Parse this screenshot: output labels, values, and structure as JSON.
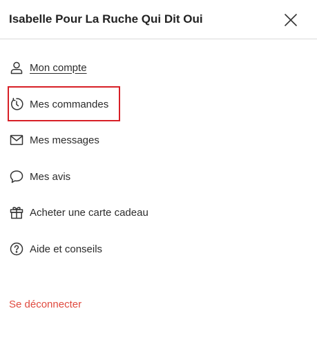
{
  "header": {
    "title": "Isabelle Pour La Ruche Qui Dit Oui",
    "close_icon": "close-icon"
  },
  "menu": {
    "items": [
      {
        "label": "Mon compte",
        "icon": "user-icon"
      },
      {
        "label": "Mes commandes",
        "icon": "history-icon"
      },
      {
        "label": "Mes messages",
        "icon": "mail-icon"
      },
      {
        "label": "Mes avis",
        "icon": "speech-bubble-icon"
      },
      {
        "label": "Acheter une carte cadeau",
        "icon": "gift-icon"
      },
      {
        "label": "Aide et conseils",
        "icon": "help-icon"
      }
    ]
  },
  "logout": {
    "label": "Se déconnecter"
  },
  "colors": {
    "text": "#2b2b2b",
    "logout": "#e04a3f",
    "highlight": "#d71f26",
    "divider": "#dadada"
  }
}
